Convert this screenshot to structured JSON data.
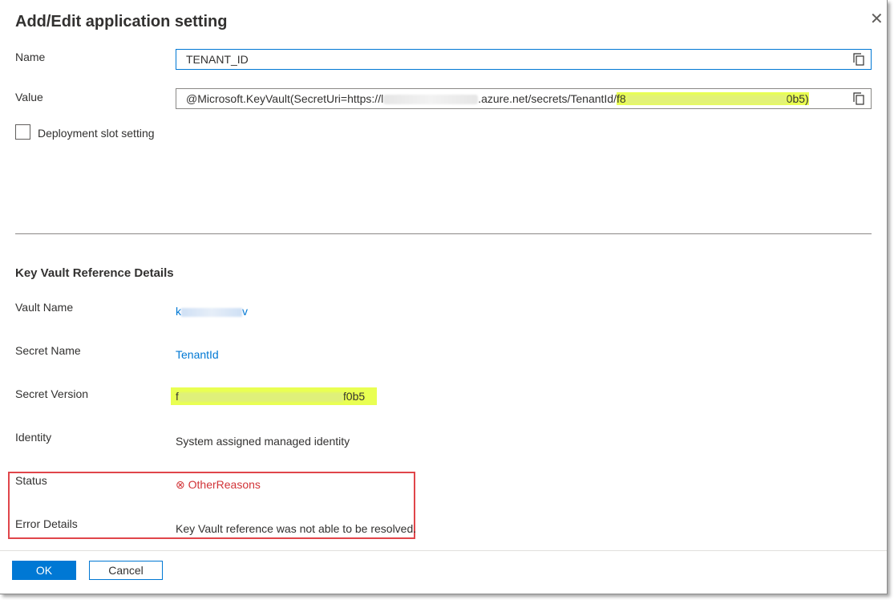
{
  "dialog": {
    "title": "Add/Edit application setting",
    "close_icon": "✕"
  },
  "form": {
    "name_label": "Name",
    "name_value": "TENANT_ID",
    "value_label": "Value",
    "value_prefix": "@Microsoft.KeyVault(SecretUri=https://",
    "value_prefix_tail": "l",
    "value_mid": ".azure.net/secrets/TenantId/",
    "value_hl_start": "f8",
    "value_hl_end": "0b5)",
    "deployment_slot_label": "Deployment slot setting",
    "deployment_slot_checked": false
  },
  "kv": {
    "section_title": "Key Vault Reference Details",
    "vault_name_label": "Vault Name",
    "vault_name_start": "k",
    "vault_name_end": "v",
    "secret_name_label": "Secret Name",
    "secret_name_value": "TenantId",
    "secret_version_label": "Secret Version",
    "secret_version_start": "f",
    "secret_version_end": "f0b5",
    "identity_label": "Identity",
    "identity_value": "System assigned managed identity",
    "status_label": "Status",
    "status_icon": "⊗",
    "status_value": "OtherReasons",
    "error_details_label": "Error Details",
    "error_details_value": "Key Vault reference was not able to be resolved."
  },
  "footer": {
    "ok_label": "OK",
    "cancel_label": "Cancel"
  },
  "colors": {
    "accent": "#0078d4",
    "error": "#d13438",
    "highlight": "#e9ff52",
    "status_box_border": "#e0464a"
  }
}
